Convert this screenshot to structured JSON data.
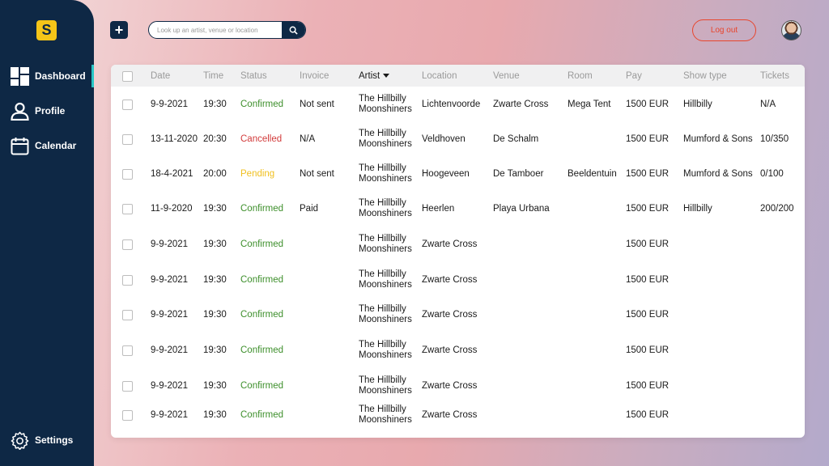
{
  "sidebar": {
    "logo_letter": "S",
    "items": [
      {
        "label": "Dashboard",
        "icon": "dashboard-icon",
        "active": true
      },
      {
        "label": "Profile",
        "icon": "user-icon",
        "active": false
      },
      {
        "label": "Calendar",
        "icon": "calendar-icon",
        "active": false
      }
    ],
    "settings_label": "Settings"
  },
  "header": {
    "add_label": "+",
    "search_placeholder": "Look up an artist, venue or location",
    "logout_label": "Log out"
  },
  "table": {
    "columns": [
      "Date",
      "Time",
      "Status",
      "Invoice",
      "Artist",
      "Location",
      "Venue",
      "Room",
      "Pay",
      "Show type",
      "Tickets"
    ],
    "sorted_column": "Artist",
    "rows": [
      {
        "date": "9-9-2021",
        "time": "19:30",
        "status": "Confirmed",
        "invoice": "Not sent",
        "artist1": "The Hillbilly",
        "artist2": "Moonshiners",
        "location": "Lichtenvoorde",
        "venue": "Zwarte Cross",
        "room": "Mega Tent",
        "pay": "1500 EUR",
        "show_type": "Hillbilly",
        "tickets": "N/A"
      },
      {
        "date": "13-11-2020",
        "time": "20:30",
        "status": "Cancelled",
        "invoice": "N/A",
        "artist1": "The Hillbilly",
        "artist2": "Moonshiners",
        "location": "Veldhoven",
        "venue": "De Schalm",
        "room": "",
        "pay": "1500 EUR",
        "show_type": "Mumford & Sons",
        "tickets": "10/350"
      },
      {
        "date": "18-4-2021",
        "time": "20:00",
        "status": "Pending",
        "invoice": "Not sent",
        "artist1": "The Hillbilly",
        "artist2": "Moonshiners",
        "location": "Hoogeveen",
        "venue": "De Tamboer",
        "room": "Beeldentuin",
        "pay": "1500 EUR",
        "show_type": "Mumford & Sons",
        "tickets": "0/100"
      },
      {
        "date": "11-9-2020",
        "time": "19:30",
        "status": "Confirmed",
        "invoice": "Paid",
        "artist1": "The Hillbilly",
        "artist2": "Moonshiners",
        "location": "Heerlen",
        "venue": "Playa Urbana",
        "room": "",
        "pay": "1500 EUR",
        "show_type": "Hillbilly",
        "tickets": "200/200"
      },
      {
        "date": "9-9-2021",
        "time": "19:30",
        "status": "Confirmed",
        "invoice": "",
        "artist1": "The Hillbilly",
        "artist2": "Moonshiners",
        "location": "Zwarte Cross",
        "venue": "",
        "room": "",
        "pay": "1500 EUR",
        "show_type": "",
        "tickets": ""
      },
      {
        "date": "9-9-2021",
        "time": "19:30",
        "status": "Confirmed",
        "invoice": "",
        "artist1": "The Hillbilly",
        "artist2": "Moonshiners",
        "location": "Zwarte Cross",
        "venue": "",
        "room": "",
        "pay": "1500 EUR",
        "show_type": "",
        "tickets": ""
      },
      {
        "date": "9-9-2021",
        "time": "19:30",
        "status": "Confirmed",
        "invoice": "",
        "artist1": "The Hillbilly",
        "artist2": "Moonshiners",
        "location": "Zwarte Cross",
        "venue": "",
        "room": "",
        "pay": "1500 EUR",
        "show_type": "",
        "tickets": ""
      },
      {
        "date": "9-9-2021",
        "time": "19:30",
        "status": "Confirmed",
        "invoice": "",
        "artist1": "The Hillbilly",
        "artist2": "Moonshiners",
        "location": "Zwarte Cross",
        "venue": "",
        "room": "",
        "pay": "1500 EUR",
        "show_type": "",
        "tickets": ""
      },
      {
        "date": "9-9-2021",
        "time": "19:30",
        "status": "Confirmed",
        "invoice": "",
        "artist1": "The Hillbilly",
        "artist2": "Moonshiners",
        "location": "Zwarte Cross",
        "venue": "",
        "room": "",
        "pay": "1500 EUR",
        "show_type": "",
        "tickets": ""
      },
      {
        "date": "9-9-2021",
        "time": "19:30",
        "status": "Confirmed",
        "invoice": "",
        "artist1": "The Hillbilly",
        "artist2": "Moonshiners",
        "location": "Zwarte Cross",
        "venue": "",
        "room": "",
        "pay": "1500 EUR",
        "show_type": "",
        "tickets": ""
      }
    ]
  },
  "colors": {
    "sidebar": "#0e2845",
    "accent": "#27c6c6",
    "logo": "#f5c518",
    "logout": "#e8452c",
    "confirmed": "#3d8f2b",
    "cancelled": "#d23b3b",
    "pending": "#f0c020"
  }
}
